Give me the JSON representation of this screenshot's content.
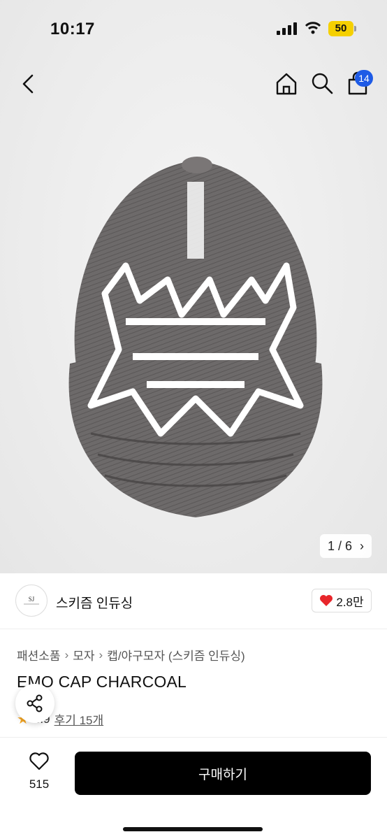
{
  "status": {
    "time": "10:17",
    "battery": "50"
  },
  "header": {
    "cart_count": "14"
  },
  "product": {
    "image_pager": "1 / 6",
    "brand": "스키즘 인듀싱",
    "likes": "2.8만",
    "breadcrumb": [
      "패션소품",
      "모자",
      "캡/야구모자 (스키즘 인듀싱)"
    ],
    "title": "EMO CAP CHARCOAL",
    "rating": "4.9",
    "reviews": "후기 15개"
  },
  "bottom": {
    "wish_count": "515",
    "buy_label": "구매하기"
  },
  "icons": [
    "back-icon",
    "home-icon",
    "search-icon",
    "cart-icon",
    "heart-icon",
    "share-icon",
    "star-icon"
  ]
}
